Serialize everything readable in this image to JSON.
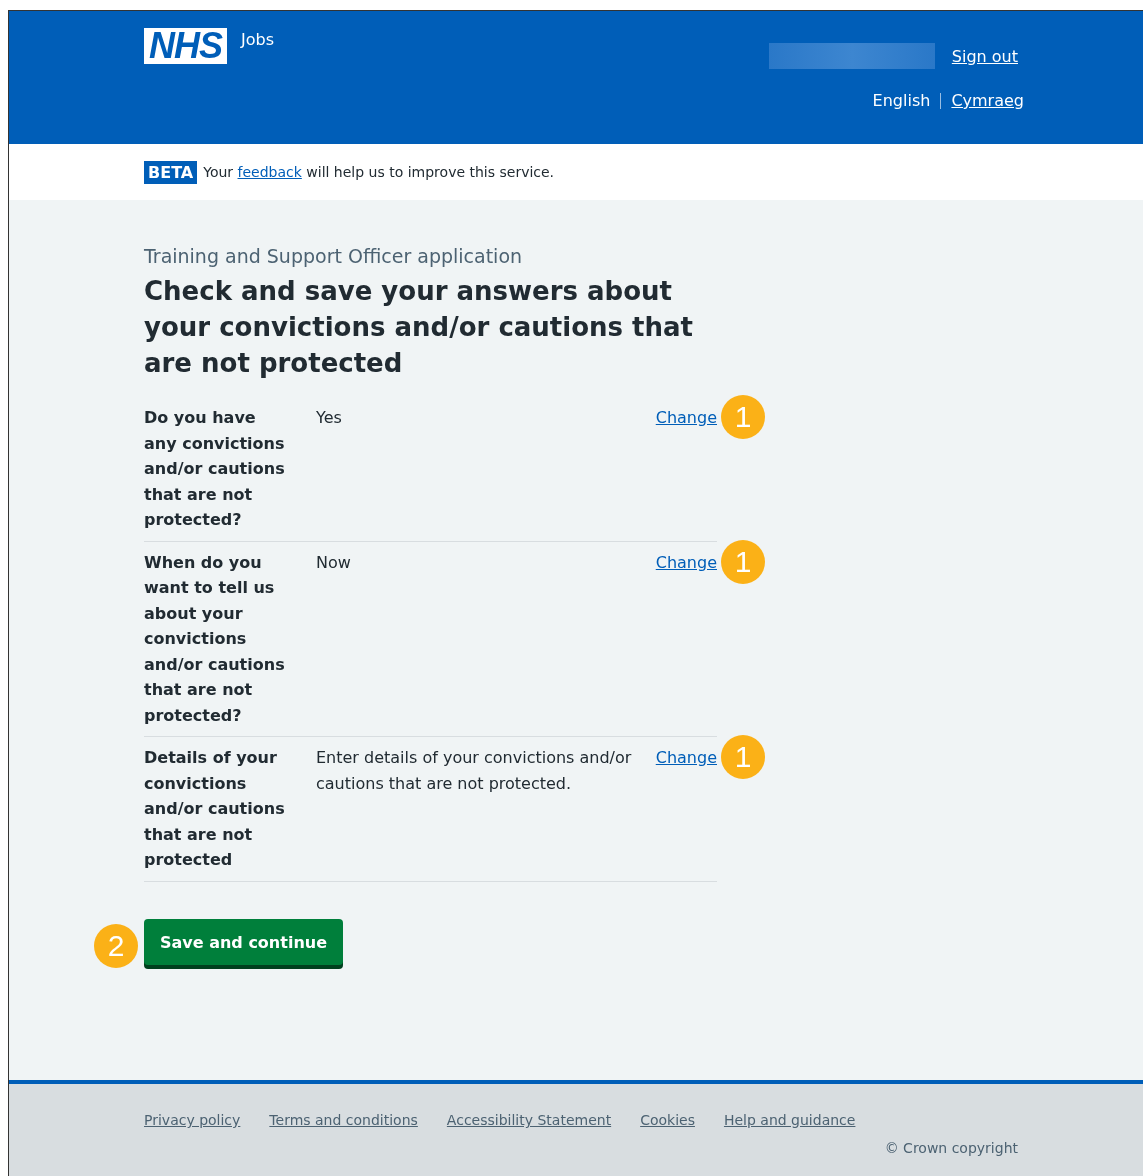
{
  "header": {
    "logo": "NHS",
    "service": "Jobs",
    "sign_out": "Sign out",
    "languages": [
      {
        "label": "English",
        "selected": true
      },
      {
        "label": "Cymraeg",
        "selected": false
      }
    ]
  },
  "phase_banner": {
    "tag": "BETA",
    "before": "Your",
    "link": "feedback",
    "after": "will help us to improve this service."
  },
  "caption": "Training and Support Officer application",
  "heading": "Check and save your answers about your convictions and/or cautions that are not protected",
  "summary": [
    {
      "question": "Do you have any convictions and/or cautions that are not protected?",
      "answer": "Yes",
      "action": "Change",
      "callout": "1"
    },
    {
      "question": "When do you want to tell us about your convictions and/or cautions that are not protected?",
      "answer": "Now",
      "action": "Change",
      "callout": "1"
    },
    {
      "question": "Details of your convictions and/or cautions that are not protected",
      "answer": "Enter details of your convictions and/or cautions that are not protected.",
      "action": "Change",
      "callout": "1"
    }
  ],
  "button": {
    "label": "Save and continue",
    "callout": "2"
  },
  "footer": {
    "links": [
      "Privacy policy",
      "Terms and conditions",
      "Accessibility Statement",
      "Cookies",
      "Help and guidance"
    ],
    "copyright": "© Crown copyright"
  }
}
